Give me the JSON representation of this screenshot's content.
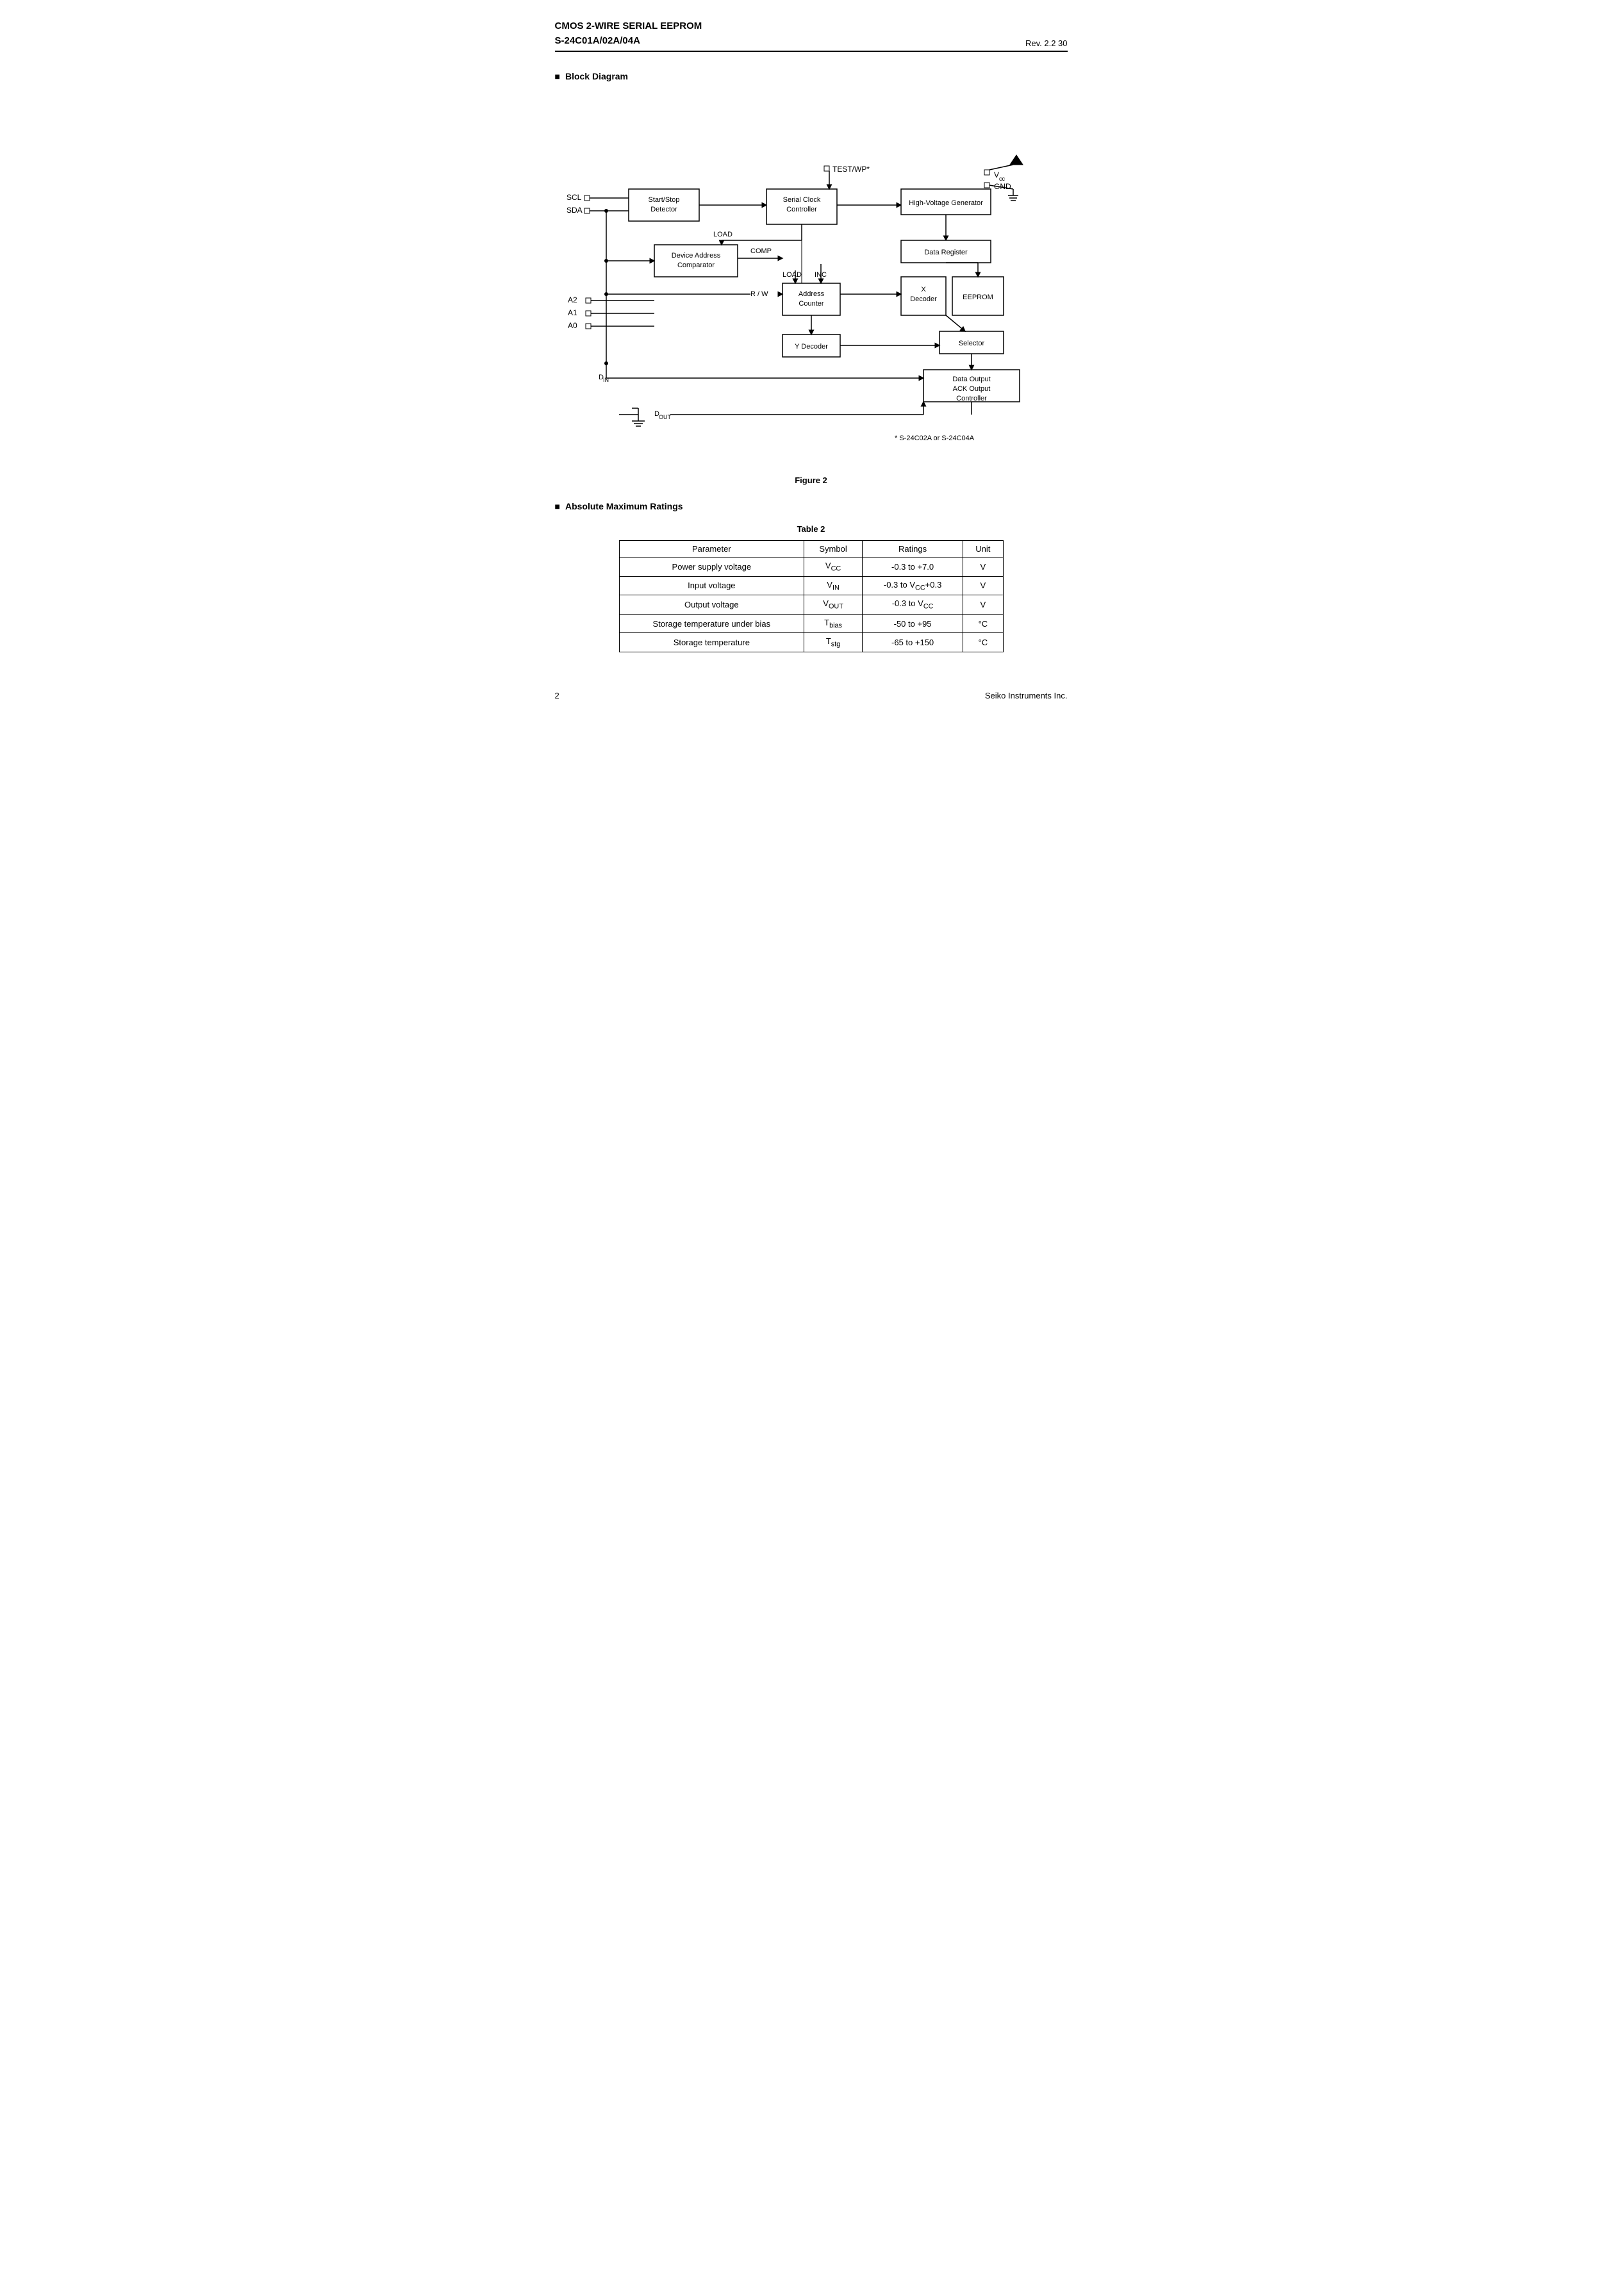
{
  "header": {
    "title_line1": "CMOS 2-WIRE SERIAL  EEPROM",
    "title_line2": "S-24C01A/02A/04A",
    "revision": "Rev. 2.2  30"
  },
  "sections": {
    "block_diagram": {
      "label": "Block Diagram",
      "figure_caption": "Figure 2",
      "footnote": "*   S-24C02A or S-24C04A"
    },
    "absolute_max": {
      "label": "Absolute Maximum Ratings",
      "table_caption": "Table  2",
      "table_headers": [
        "Parameter",
        "Symbol",
        "Ratings",
        "Unit"
      ],
      "table_rows": [
        [
          "Power supply voltage",
          "Vₙₑ (VCC)",
          "-0.3 to +7.0",
          "V"
        ],
        [
          "Input voltage",
          "Vᴵₙ (VIN)",
          "-0.3 to Vₙₑ+0.3",
          "V"
        ],
        [
          "Output voltage",
          "Vₒᵁᵀ (VOUT)",
          "-0.3 to Vₙₑ",
          "V"
        ],
        [
          "Storage temperature under bias",
          "Tᵇᴵₐˢ (Tbias)",
          "-50 to +95",
          "°C"
        ],
        [
          "Storage temperature",
          "Tˢᵀᵍ (Tstg)",
          "-65 to +150",
          "°C"
        ]
      ]
    }
  },
  "footer": {
    "page_number": "2",
    "company": "Seiko Instruments Inc."
  }
}
